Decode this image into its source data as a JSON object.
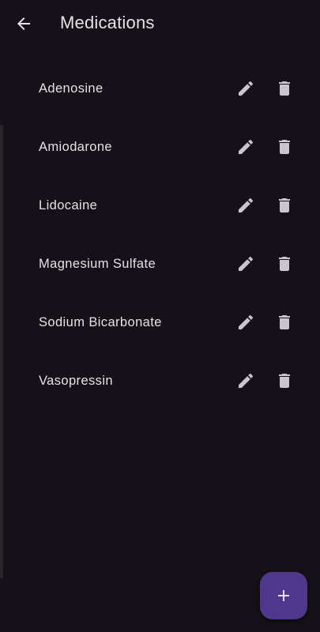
{
  "app_bar": {
    "title": "Medications",
    "back_icon": "arrow-back-icon"
  },
  "medications": [
    {
      "name": "Adenosine"
    },
    {
      "name": "Amiodarone"
    },
    {
      "name": "Lidocaine"
    },
    {
      "name": "Magnesium Sulfate"
    },
    {
      "name": "Sodium Bicarbonate"
    },
    {
      "name": "Vasopressin"
    }
  ],
  "item_actions": {
    "edit_icon": "pencil-icon",
    "delete_icon": "trash-icon"
  },
  "fab": {
    "icon": "plus-icon"
  },
  "colors": {
    "background": "#141218",
    "text": "#e6e1e5",
    "icon": "#cac4d0",
    "fab_background": "#4f378b",
    "fab_icon": "#eaddff"
  }
}
